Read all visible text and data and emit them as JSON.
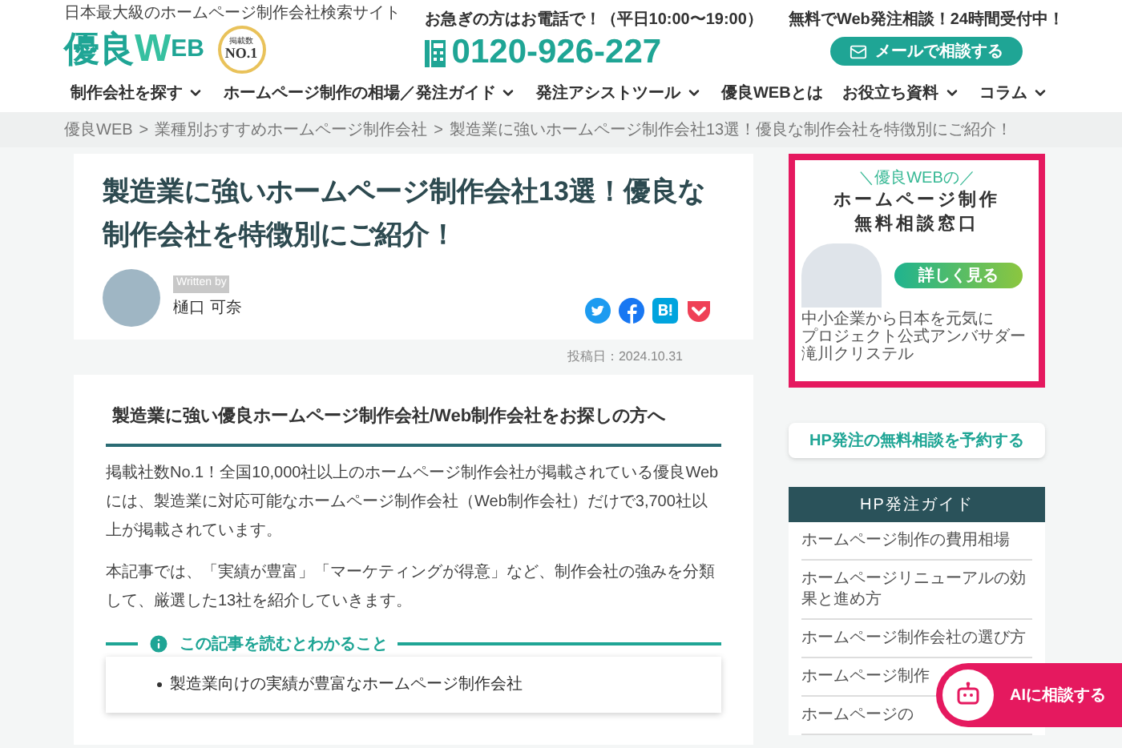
{
  "header": {
    "tagline": "日本最大級のホームページ制作会社検索サイト",
    "logo": {
      "main": "優良",
      "accent": "W",
      "rest": "EB"
    },
    "badge": {
      "top": "掲載数",
      "main": "NO.1"
    },
    "phone": {
      "note": "お急ぎの方はお電話で！（平日10:00〜19:00）",
      "number": "0120-926-227"
    },
    "mail": {
      "note": "無料でWeb発注相談！24時間受付中！",
      "button": "メールで相談する"
    }
  },
  "nav": [
    {
      "label": "制作会社を探す",
      "dropdown": true
    },
    {
      "label": "ホームページ制作の相場／発注ガイド",
      "dropdown": true
    },
    {
      "label": "発注アシストツール",
      "dropdown": true
    },
    {
      "label": "優良WEBとは",
      "dropdown": false
    },
    {
      "label": "お役立ち資料",
      "dropdown": true
    },
    {
      "label": "コラム",
      "dropdown": true
    }
  ],
  "breadcrumb": [
    {
      "label": "優良WEB"
    },
    {
      "separator": ">",
      "label": "業種別おすすめホームページ制作会社"
    },
    {
      "separator": ">",
      "label": "製造業に強いホームページ制作会社13選！優良な制作会社を特徴別にご紹介！"
    }
  ],
  "article": {
    "title": "製造業に強いホームページ制作会社13選！優良な制作会社を特徴別にご紹介！",
    "author_label": "Written by",
    "author": "樋口 可奈",
    "date": "投稿日：2024.10.31",
    "heading": "製造業に強い優良ホームページ制作会社/Web制作会社をお探しの方へ",
    "paragraphs": [
      "掲載社数No.1！全国10,000社以上のホームページ制作会社が掲載されている優良Webには、製造業に対応可能なホームページ制作会社（Web制作会社）だけで3,700社以上が掲載されています。",
      "本記事では、「実績が豊富」「マーケティングが得意」など、制作会社の強みを分類して、厳選した13社を紹介していきます。"
    ],
    "summary": {
      "title": "この記事を読むとわかること",
      "items": [
        "製造業向けの実績が豊富なホームページ制作会社"
      ]
    }
  },
  "banner": {
    "kicker": "＼優良WEBの／",
    "title_lines": [
      "ホームページ制作",
      "無料相談窓口"
    ],
    "button": "詳しく見る",
    "caption_lines": [
      "中小企業から日本を元気に",
      "プロジェクト公式アンバサダー",
      "滝川クリステル"
    ]
  },
  "consult_button": "HP発注の無料相談を予約する",
  "guide": {
    "title": "HP発注ガイド",
    "items": [
      "ホームページ制作の費用相場",
      "ホームページリニューアルの効果と進め方",
      "ホームページ制作会社の選び方",
      "ホームページ制作",
      "ホームページの"
    ]
  },
  "ai_button": "AIに相談する"
}
